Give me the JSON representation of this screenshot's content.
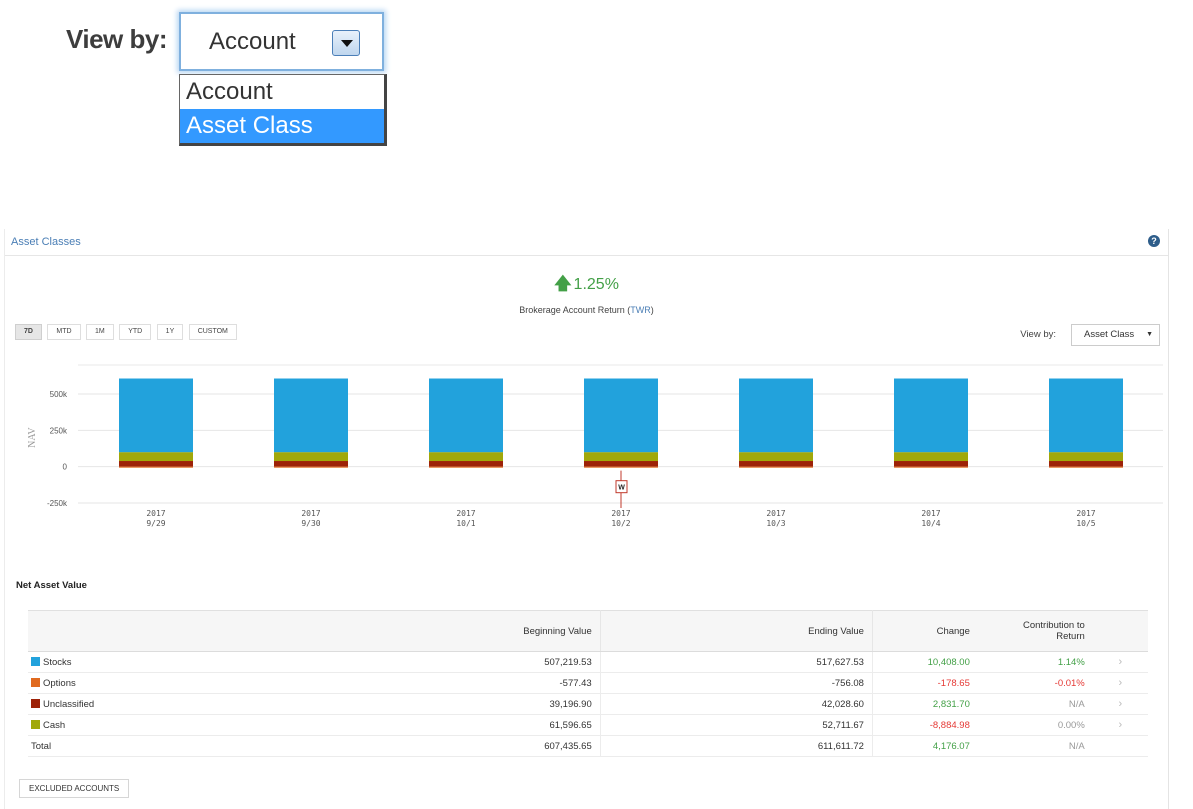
{
  "zoom": {
    "label": "View by:",
    "selected": "Account",
    "options": [
      "Account",
      "Asset Class"
    ],
    "highlighted_option": "Asset Class"
  },
  "panel": {
    "title": "Asset Classes",
    "help": "?"
  },
  "return": {
    "value": "1.25%",
    "label_prefix": "Brokerage Account Return (",
    "label_link": "TWR",
    "label_suffix": ")"
  },
  "periods": [
    "7D",
    "MTD",
    "1M",
    "YTD",
    "1Y",
    "CUSTOM"
  ],
  "active_period": "7D",
  "view_by": {
    "label": "View by:",
    "selected": "Asset Class"
  },
  "chart_data": {
    "type": "bar",
    "stacked": true,
    "ylabel": "NAV",
    "ylim": [
      -250000,
      700000
    ],
    "yticks": [
      -250000,
      0,
      250000,
      500000
    ],
    "ytick_labels": [
      "-250k",
      "0",
      "250k",
      "500k"
    ],
    "categories": [
      {
        "year": "2017",
        "date": "9/29"
      },
      {
        "year": "2017",
        "date": "9/30"
      },
      {
        "year": "2017",
        "date": "10/1"
      },
      {
        "year": "2017",
        "date": "10/2"
      },
      {
        "year": "2017",
        "date": "10/3"
      },
      {
        "year": "2017",
        "date": "10/4"
      },
      {
        "year": "2017",
        "date": "10/5"
      }
    ],
    "series": [
      {
        "name": "Stocks",
        "color": "#22a2dc",
        "values": [
          507000,
          507000,
          507000,
          507000,
          507000,
          507000,
          507000
        ]
      },
      {
        "name": "Options",
        "color": "#e06a1f",
        "values": [
          -600,
          -600,
          -600,
          -600,
          -600,
          -600,
          -600
        ]
      },
      {
        "name": "Unclassified",
        "color": "#9d2208",
        "values": [
          39000,
          39000,
          39000,
          39000,
          39000,
          39000,
          39000
        ]
      },
      {
        "name": "Cash",
        "color": "#a1a80a",
        "values": [
          61000,
          61000,
          61000,
          61000,
          61000,
          61000,
          61000
        ]
      }
    ],
    "marker": {
      "category_index": 3,
      "label": "W"
    },
    "grid": true,
    "legend": "none"
  },
  "nav": {
    "title": "Net Asset Value",
    "headers": {
      "begin": "Beginning Value",
      "end": "Ending Value",
      "change": "Change",
      "contrib_1": "Contribution to",
      "contrib_2": "Return"
    },
    "rows": [
      {
        "name": "Stocks",
        "color": "#22a2dc",
        "begin": "507,219.53",
        "end": "517,627.53",
        "change": "10,408.00",
        "change_class": "pos",
        "contrib": "1.14%",
        "contrib_class": "pos"
      },
      {
        "name": "Options",
        "color": "#e06a1f",
        "begin": "-577.43",
        "end": "-756.08",
        "change": "-178.65",
        "change_class": "neg",
        "contrib": "-0.01%",
        "contrib_class": "neg"
      },
      {
        "name": "Unclassified",
        "color": "#9d2208",
        "begin": "39,196.90",
        "end": "42,028.60",
        "change": "2,831.70",
        "change_class": "pos",
        "contrib": "N/A",
        "contrib_class": "na"
      },
      {
        "name": "Cash",
        "color": "#a1a80a",
        "begin": "61,596.65",
        "end": "52,711.67",
        "change": "-8,884.98",
        "change_class": "neg",
        "contrib": "0.00%",
        "contrib_class": "na"
      }
    ],
    "total": {
      "name": "Total",
      "begin": "607,435.65",
      "end": "611,611.72",
      "change": "4,176.07",
      "contrib": "N/A"
    },
    "row_arrow": "›"
  },
  "excluded_button": "EXCLUDED ACCOUNTS"
}
